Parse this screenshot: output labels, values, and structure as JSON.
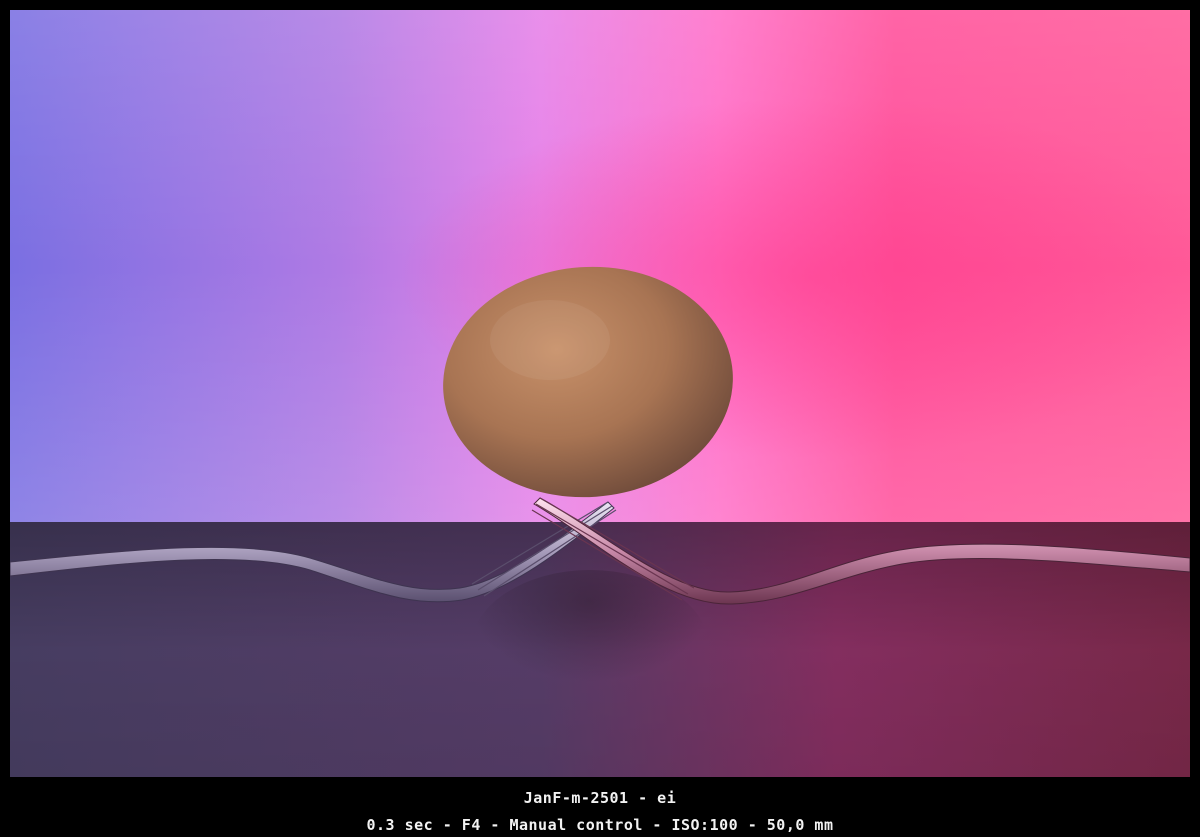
{
  "caption": {
    "title": "JanF-m-2501 - ei",
    "exposure": "0.3 sec - F4 - Manual control - ISO:100 - 50,0 mm"
  },
  "colors": {
    "border": "#000000",
    "background_left": "#7b6ee0",
    "background_mid": "#ee7ee6",
    "background_right": "#ff4f93",
    "table_left": "#3d3552",
    "table_right": "#7a2a4a",
    "egg": "#b07a55",
    "fork": "#c9c3d6"
  }
}
